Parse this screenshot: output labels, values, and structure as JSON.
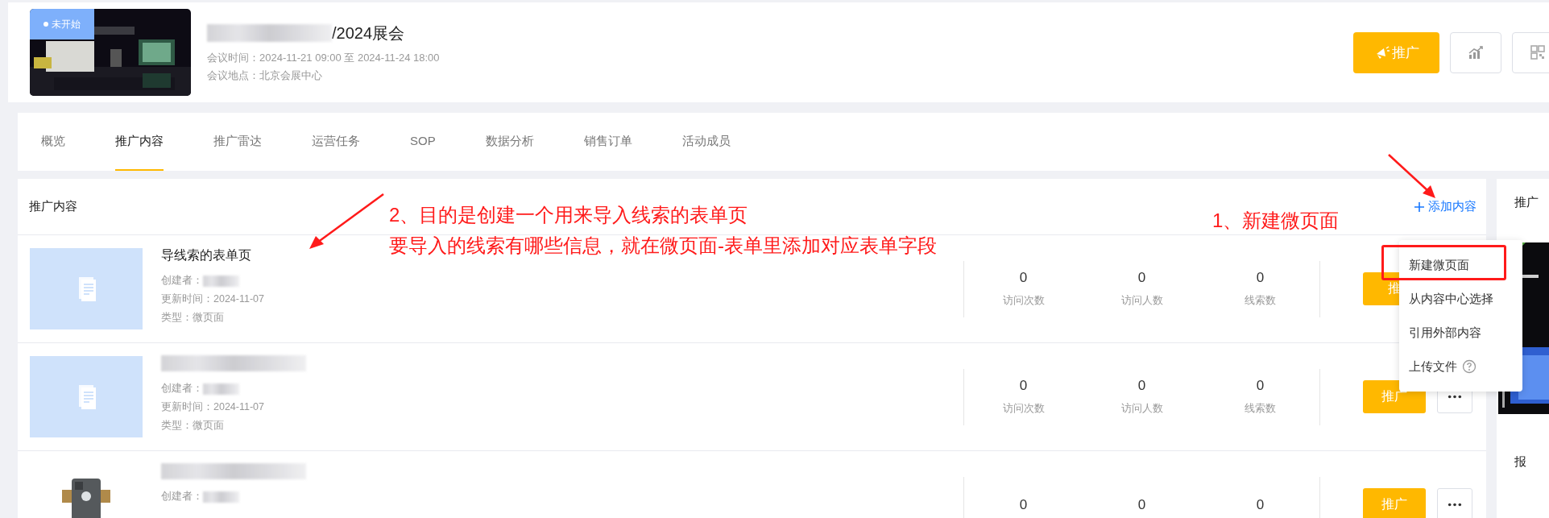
{
  "header": {
    "status": "未开始",
    "title_redacted": true,
    "title": "/2024展会",
    "meta": [
      "会议时间：2024-11-21 09:00 至 2024-11-24 18:00",
      "会议地点：北京会展中心"
    ],
    "promote_button": "推广"
  },
  "tabs": [
    {
      "label": "概览",
      "selected": false
    },
    {
      "label": "推广内容",
      "selected": true
    },
    {
      "label": "推广雷达",
      "selected": false
    },
    {
      "label": "运营任务",
      "selected": false
    },
    {
      "label": "SOP",
      "selected": false
    },
    {
      "label": "数据分析",
      "selected": false
    },
    {
      "label": "销售订单",
      "selected": false
    },
    {
      "label": "活动成员",
      "selected": false
    }
  ],
  "content": {
    "title": "推广内容",
    "add_button": "添加内容",
    "rows": [
      {
        "kind": "document",
        "title": "导线索的表单页",
        "title_redacted": false,
        "creator": "创建者：",
        "meta": [
          "更新时间：2024-11-07",
          "类型：微页面"
        ],
        "stats": [
          {
            "value": "0",
            "label": "访问次数"
          },
          {
            "value": "0",
            "label": "访问人数"
          },
          {
            "value": "0",
            "label": "线索数"
          }
        ],
        "promote": "推",
        "more": false
      },
      {
        "kind": "document",
        "title_redacted": true,
        "creator": "创建者：",
        "meta": [
          "更新时间：2024-11-07",
          "类型：微页面"
        ],
        "stats": [
          {
            "value": "0",
            "label": "访问次数"
          },
          {
            "value": "0",
            "label": "访问人数"
          },
          {
            "value": "0",
            "label": "线索数"
          }
        ],
        "promote": "推广",
        "more": true
      },
      {
        "kind": "picture",
        "title_redacted": true,
        "creator": "创建者：",
        "stats": [
          {
            "value": "0"
          },
          {
            "value": "0"
          },
          {
            "value": "0"
          }
        ],
        "promote": "推广",
        "more": true
      }
    ]
  },
  "dropdown": {
    "items": [
      {
        "label": "新建微页面",
        "help": false,
        "highlighted": true
      },
      {
        "label": "从内容中心选择",
        "help": false,
        "highlighted": false
      },
      {
        "label": "引用外部内容",
        "help": false,
        "highlighted": false
      },
      {
        "label": "上传文件",
        "help": true,
        "highlighted": false
      }
    ]
  },
  "side_card": {
    "title": "推广",
    "caption": "报"
  },
  "annotations": [
    {
      "lines": [
        "2、目的是创建一个用来导入线索的表单页",
        "要导入的线索有哪些信息，就在微页面-表单里添加对应表单字段"
      ]
    },
    {
      "lines": [
        "1、新建微页面"
      ]
    }
  ]
}
